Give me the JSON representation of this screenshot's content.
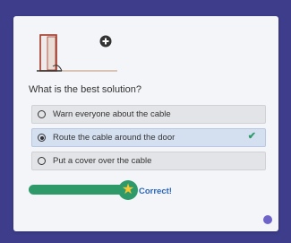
{
  "question": "What is the best solution?",
  "options": [
    {
      "label": "Warn everyone about the cable",
      "selected": false
    },
    {
      "label": "Route the cable around the door",
      "selected": true
    },
    {
      "label": "Put a cover over the cable",
      "selected": false
    }
  ],
  "feedback": "Correct!",
  "icons": {
    "illustration": "door-with-cable-illustration",
    "expand": "plus-circle-icon",
    "check": "checkmark-icon",
    "star": "star-icon",
    "corner": "help-dot-icon"
  },
  "colors": {
    "background": "#3e3d8c",
    "card": "#f4f5f8",
    "accent_green": "#2e9a6a",
    "star": "#f5c533",
    "feedback": "#2a66b8",
    "selected_option": "#d4dff0"
  }
}
